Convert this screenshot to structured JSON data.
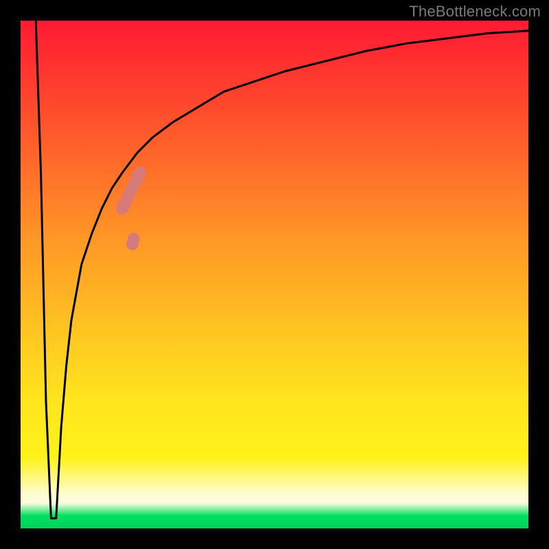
{
  "watermark": "TheBottleneck.com",
  "chart_data": {
    "type": "line",
    "title": "",
    "xlabel": "",
    "ylabel": "",
    "xlim": [
      0,
      100
    ],
    "ylim": [
      0,
      100
    ],
    "grid": false,
    "legend": false,
    "annotations": [],
    "series": [
      {
        "name": "curve",
        "x": [
          3,
          4,
          5,
          6,
          7,
          8,
          9,
          10,
          12,
          14,
          16,
          18,
          20,
          23,
          26,
          30,
          35,
          40,
          46,
          52,
          60,
          68,
          76,
          84,
          92,
          100
        ],
        "y": [
          100,
          70,
          25,
          2,
          2,
          20,
          32,
          41,
          52,
          58,
          63,
          67,
          70,
          74,
          77,
          80,
          83,
          86,
          88,
          90,
          92,
          94,
          95.5,
          96.5,
          97.5,
          98
        ]
      },
      {
        "name": "highlight-points",
        "x": [
          20,
          20.5,
          21,
          21.5,
          22,
          22.5,
          23,
          23.5,
          22,
          22.3
        ],
        "y": [
          63,
          64,
          65,
          66,
          67,
          68,
          69,
          70,
          56,
          57
        ]
      }
    ],
    "colors": {
      "curve": "#000000",
      "highlight": "#d67b7a"
    }
  }
}
